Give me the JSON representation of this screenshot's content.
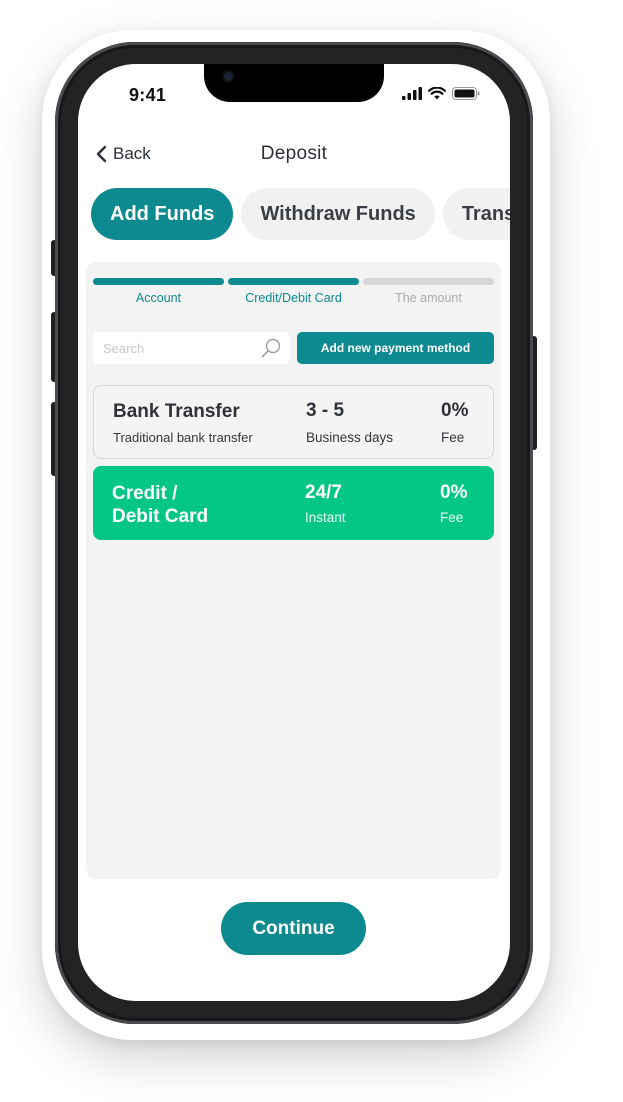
{
  "status_bar": {
    "time": "9:41",
    "icons": [
      "signal-icon",
      "wifi-icon",
      "battery-icon"
    ]
  },
  "header": {
    "back_label": "Back",
    "title": "Deposit"
  },
  "tabs": [
    {
      "label": "Add Funds",
      "active": true
    },
    {
      "label": "Withdraw Funds",
      "active": false
    },
    {
      "label": "Transfer",
      "active": false
    }
  ],
  "steps": [
    {
      "label": "Account",
      "state": "done"
    },
    {
      "label": "Credit/Debit Card",
      "state": "done"
    },
    {
      "label": "The amount",
      "state": "todo"
    }
  ],
  "search": {
    "placeholder": "Search"
  },
  "add_payment_label": "Add new payment method",
  "methods": [
    {
      "name": "Bank Transfer",
      "description": "Traditional bank transfer",
      "time": "3 - 5",
      "time_label": "Business days",
      "fee": "0%",
      "fee_label": "Fee",
      "selected": false
    },
    {
      "name": "Credit /\nDebit Card",
      "description": "",
      "time": "24/7",
      "time_label": "Instant",
      "fee": "0%",
      "fee_label": "Fee",
      "selected": true
    }
  ],
  "continue_label": "Continue",
  "colors": {
    "primary": "#0c8a8f",
    "selected": "#04c785",
    "panel": "#f3f3f4"
  }
}
